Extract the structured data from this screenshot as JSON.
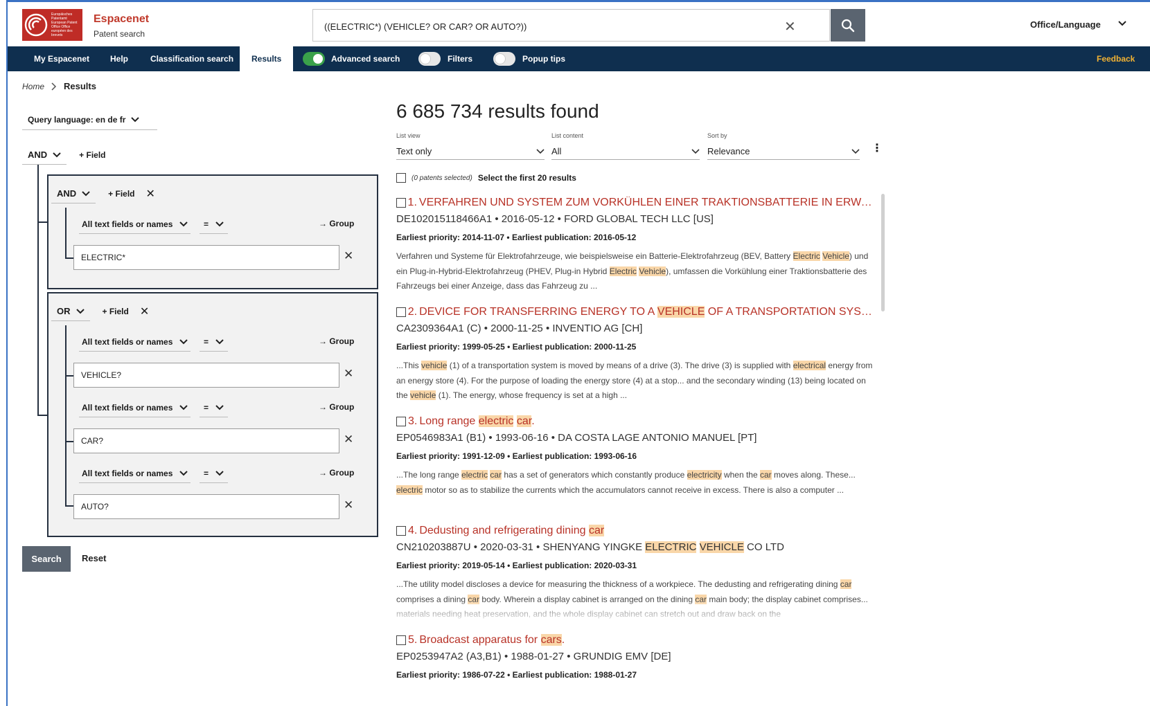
{
  "header": {
    "brand_name": "Espacenet",
    "brand_sub": "Patent search",
    "logo_text": "Europäisches Patentamt European Patent Office Office européen des brevets",
    "search_value": "((ELECTRIC*) (VEHICLE? OR CAR? OR AUTO?))",
    "office_language": "Office/Language"
  },
  "nav": {
    "my_espacenet": "My Espacenet",
    "help": "Help",
    "classification": "Classification search",
    "results": "Results",
    "advanced_search": "Advanced search",
    "filters": "Filters",
    "popup_tips": "Popup tips",
    "feedback": "Feedback"
  },
  "breadcrumb": {
    "home": "Home",
    "current": "Results"
  },
  "query": {
    "language": "Query language: en de fr",
    "root_op": "AND",
    "add_field": "+ Field",
    "group1_op": "AND",
    "group2_op": "OR",
    "field_label": "All text fields or names",
    "eq": "=",
    "to_group": "→ Group",
    "values": [
      "ELECTRIC*",
      "VEHICLE?",
      "CAR?",
      "AUTO?"
    ],
    "search_btn": "Search",
    "reset_btn": "Reset"
  },
  "results": {
    "count": "6 685 734 results found",
    "list_view_label": "List view",
    "list_view_value": "Text only",
    "list_content_label": "List content",
    "list_content_value": "All",
    "sort_label": "Sort by",
    "sort_value": "Relevance",
    "selected_count": "(0 patents selected)",
    "select_first": "Select the first 20 results",
    "items": [
      {
        "num": "1.",
        "meta": "DE102015118466A1 • 2016-05-12 • FORD GLOBAL TECH LLC [US]",
        "prio": "Earliest priority: 2014-11-07 • Earliest publication: 2016-05-12"
      },
      {
        "num": "2.",
        "meta": "CA2309364A1 (C) • 2000-11-25 • INVENTIO AG [CH]",
        "prio": "Earliest priority: 1999-05-25 • Earliest publication: 2000-11-25"
      },
      {
        "num": "3.",
        "meta": "EP0546983A1 (B1) • 1993-06-16 • DA COSTA LAGE ANTONIO MANUEL [PT]",
        "prio": "Earliest priority: 1991-12-09 • Earliest publication: 1993-06-16"
      },
      {
        "num": "4.",
        "prio": "Earliest priority: 2019-05-14 • Earliest publication: 2020-03-31"
      },
      {
        "num": "5.",
        "meta": "EP0253947A2 (A3,B1) • 1988-01-27 • GRUNDIG EMV [DE]",
        "prio": "Earliest priority: 1986-07-22 • Earliest publication: 1988-01-27"
      }
    ]
  },
  "colors": {
    "nav_bg": "#0f2f4f",
    "brand_red": "#bf2c26",
    "title_red": "#b83227",
    "highlight": "#f9d6a8",
    "feedback": "#f2b233",
    "toggle_on": "#3aa14a"
  }
}
